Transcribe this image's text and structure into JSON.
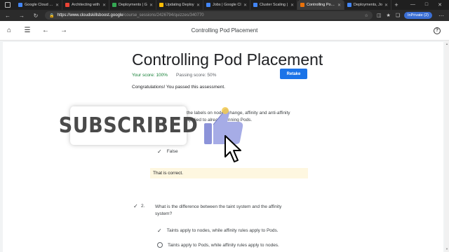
{
  "browser": {
    "tabs": [
      {
        "label": "Google Cloud Sk",
        "color": "#4285f4",
        "active": false
      },
      {
        "label": "Architecting with",
        "color": "#ea4335",
        "active": false
      },
      {
        "label": "Deployments | G",
        "color": "#34a853",
        "active": false
      },
      {
        "label": "Updating Deploy",
        "color": "#fbbc05",
        "active": false
      },
      {
        "label": "Jobs | Google Cl",
        "color": "#4285f4",
        "active": false
      },
      {
        "label": "Cluster Scaling |",
        "color": "#4285f4",
        "active": false
      },
      {
        "label": "Controlling Pod P",
        "color": "#e8710a",
        "active": true
      },
      {
        "label": "Deployments, Jo",
        "color": "#4285f4",
        "active": false
      }
    ],
    "new_tab": "+",
    "url_host": "https://www.cloudskillsboost.google",
    "url_path": "/course_sessions/2426794/quizzes/340770",
    "inprivate_label": "InPrivate (2)"
  },
  "header": {
    "title": "Controlling Pod Placement"
  },
  "quiz": {
    "title": "Controlling Pod Placement",
    "your_score": "Your score: 100%",
    "passing_score": "Passing score: 50%",
    "retake_label": "Retake",
    "congrats": "Congratulations! You passed this assessment."
  },
  "question1": {
    "text": "the labels on nodes change, affinity and anti-affinity applied to already running Pods.",
    "answer": "False",
    "feedback": "That is correct."
  },
  "question2": {
    "number": "2.",
    "text": "What is the difference between the taint system and the affinity system?",
    "options": [
      "Taints apply to nodes, while affinity rules apply to Pods.",
      "Taints apply to Pods, while affinity rules apply to nodes."
    ]
  },
  "overlay": {
    "subscribed": "SUBSCRIBED"
  },
  "colors": {
    "accent": "#1a73e8",
    "score_green": "#188038",
    "feedback_bg": "#fef7e0"
  }
}
